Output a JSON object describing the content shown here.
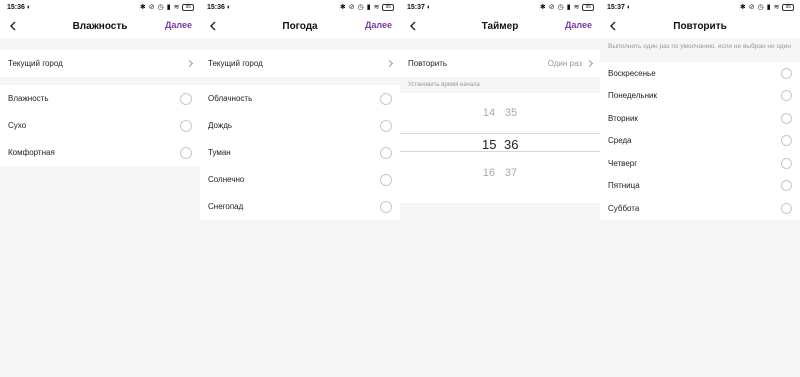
{
  "screens": [
    {
      "time": "15:36",
      "battery": "95",
      "title": "Влажность",
      "next": "Далее",
      "city_label": "Текущий город",
      "options": [
        "Влажность",
        "Сухо",
        "Комфортная"
      ]
    },
    {
      "time": "15:36",
      "battery": "95",
      "title": "Погода",
      "next": "Далее",
      "city_label": "Текущий город",
      "options": [
        "Облачность",
        "Дождь",
        "Туман",
        "Солнечно",
        "Снегопад"
      ]
    },
    {
      "time": "15:37",
      "battery": "95",
      "title": "Таймер",
      "next": "Далее",
      "repeat_label": "Повторить",
      "repeat_value": "Один раз",
      "start_hint": "Установить время начала",
      "picker": {
        "above": {
          "hour": "14",
          "minute": "35"
        },
        "selected": {
          "hour": "15",
          "minute": "36"
        },
        "below": {
          "hour": "16",
          "minute": "37"
        }
      }
    },
    {
      "time": "15:37",
      "battery": "95",
      "title": "Повторить",
      "hint": "Выполнить один раз по умолчанию, если не выбран ни один",
      "days": [
        "Воскресенье",
        "Понедельник",
        "Вторник",
        "Среда",
        "Четверг",
        "Пятница",
        "Суббота"
      ]
    }
  ],
  "icons": {
    "back": "back-arrow-icon",
    "chevron": "chevron-right-icon",
    "status": [
      "bluetooth-icon",
      "mute-icon",
      "alarm-icon",
      "signal-icon",
      "wifi-icon",
      "battery-icon"
    ]
  },
  "colors": {
    "accent": "#7a3aa0",
    "background": "#f6f6f6",
    "card": "#ffffff",
    "muted_text": "#999999"
  }
}
